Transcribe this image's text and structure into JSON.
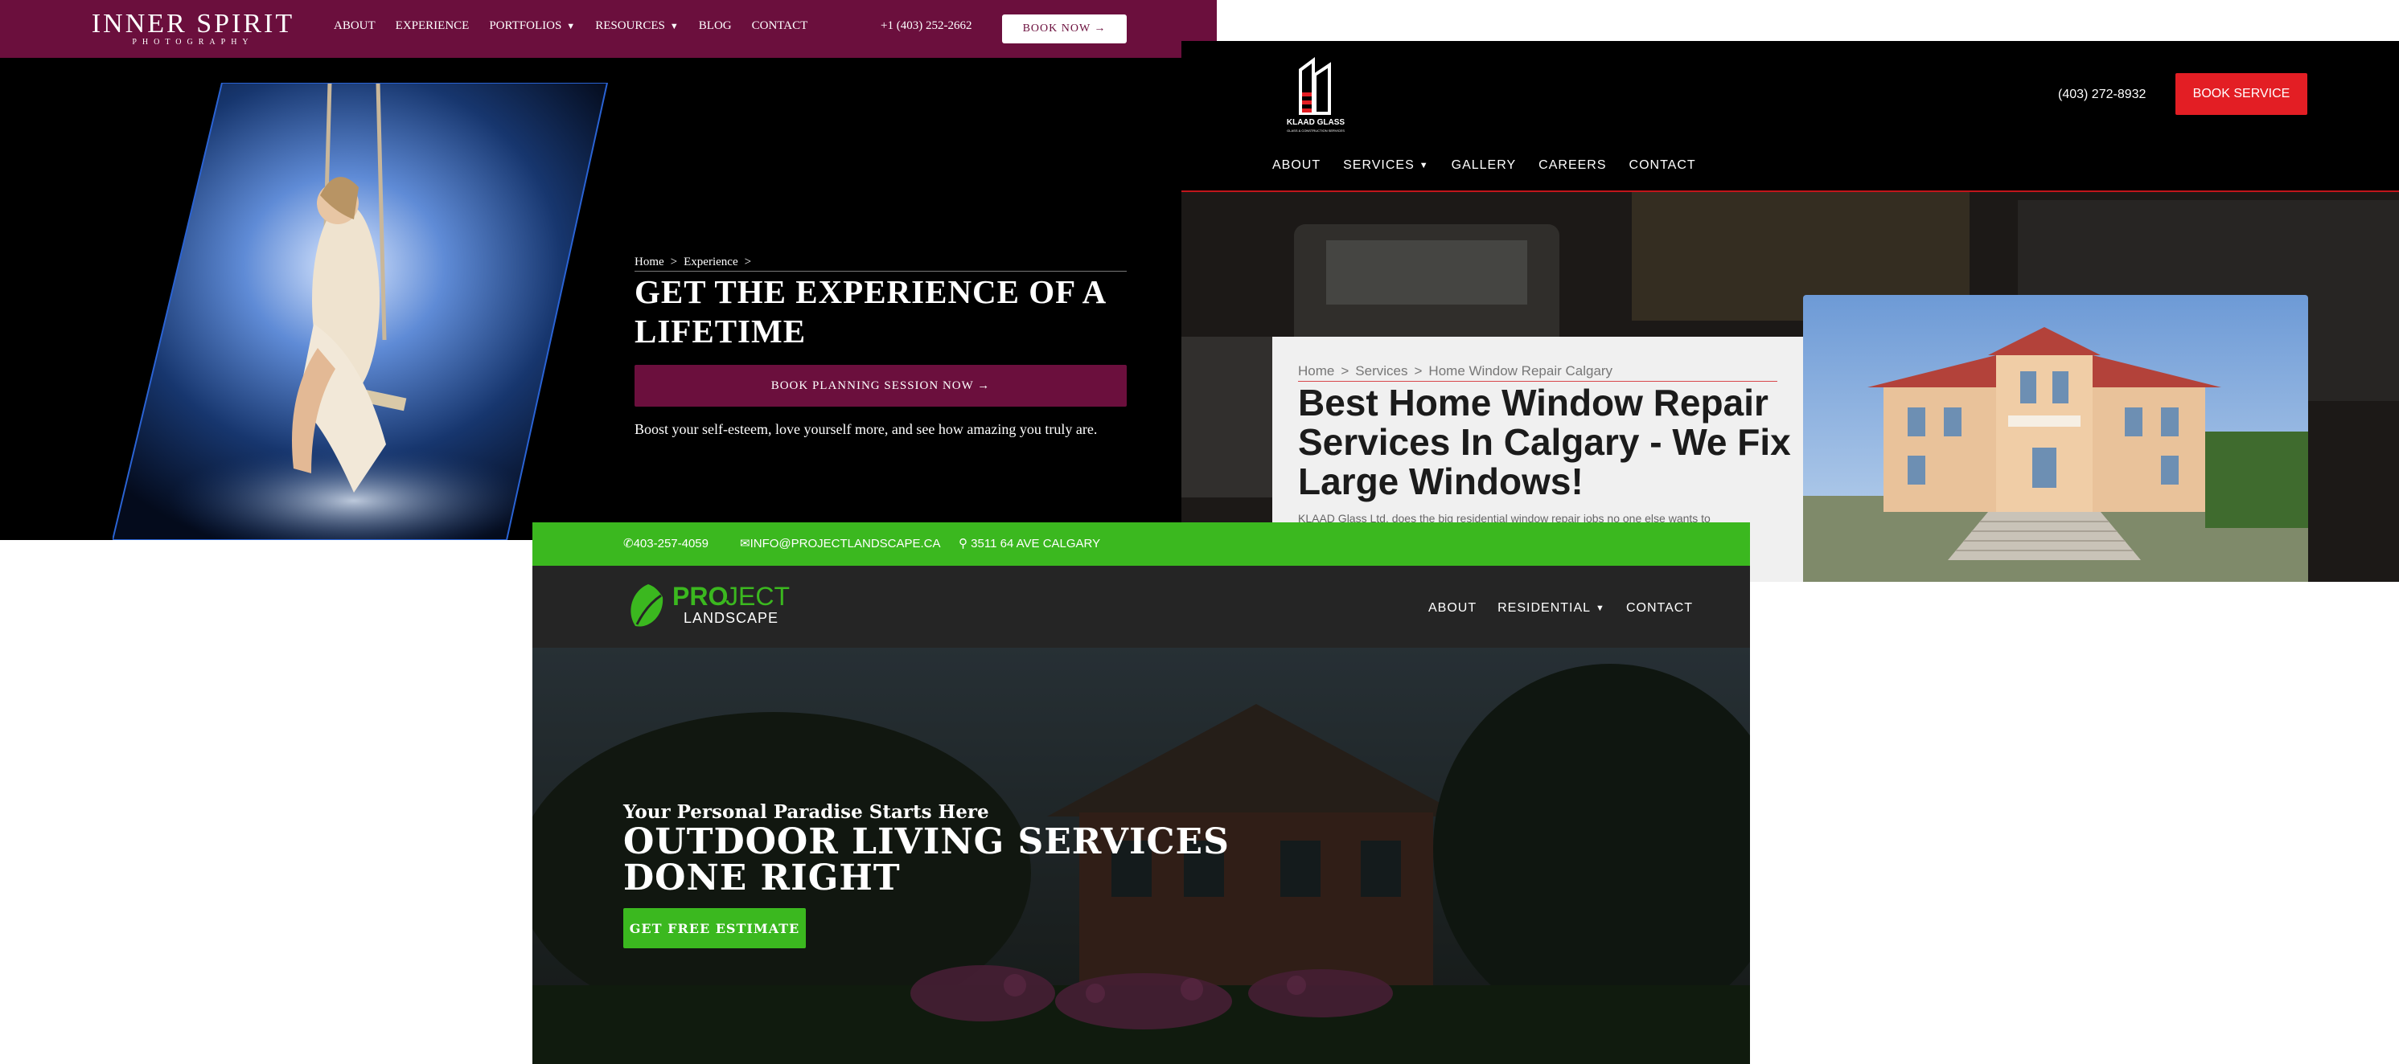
{
  "inner_spirit": {
    "logo": {
      "name": "INNER SPIRIT",
      "tagline": "PHOTOGRAPHY"
    },
    "menu": [
      "ABOUT",
      "EXPERIENCE",
      "PORTFOLIOS",
      "RESOURCES",
      "BLOG",
      "CONTACT"
    ],
    "phone": "+1 (403) 252-2662",
    "book_button": "BOOK NOW →",
    "breadcrumb": [
      "Home",
      ">",
      "Experience",
      ">"
    ],
    "headline": "GET THE EXPERIENCE OF A LIFETIME",
    "cta": "BOOK PLANNING SESSION NOW →",
    "description": "Boost your self-esteem, love yourself more, and see how amazing you truly are.",
    "colors": {
      "brand": "#6b0f3d",
      "frame": "#2a63d4"
    }
  },
  "klaad_glass": {
    "logo": {
      "name": "KLAAD GLASS",
      "tagline": "GLASS & CONSTRUCTION SERVICES"
    },
    "phone": "(403) 272-8932",
    "book_button": "BOOK SERVICE",
    "menu": [
      "ABOUT",
      "SERVICES",
      "GALLERY",
      "CAREERS",
      "CONTACT"
    ],
    "breadcrumb": [
      "Home",
      ">",
      "Services",
      ">",
      "Home Window Repair Calgary"
    ],
    "headline": "Best Home Window Repair Services In Calgary - We Fix Large Windows!",
    "description": "KLAAD Glass Ltd. does the big residential window repair jobs no one else wants to",
    "colors": {
      "brand": "#e31e24"
    }
  },
  "project_landscape": {
    "topbar": {
      "phone": "403-257-4059",
      "email": "INFO@PROJECTLANDSCAPE.CA",
      "address": "3511 64 AVE CALGARY"
    },
    "logo": {
      "pro": "PRO",
      "ject": "JECT",
      "sub": "LANDSCAPE"
    },
    "menu": [
      "ABOUT",
      "RESIDENTIAL",
      "CONTACT"
    ],
    "subheadline": "Your Personal Paradise Starts Here",
    "headline": "OUTDOOR LIVING SERVICES DONE RIGHT",
    "cta": "GET FREE ESTIMATE",
    "colors": {
      "brand": "#3bb81f"
    }
  }
}
